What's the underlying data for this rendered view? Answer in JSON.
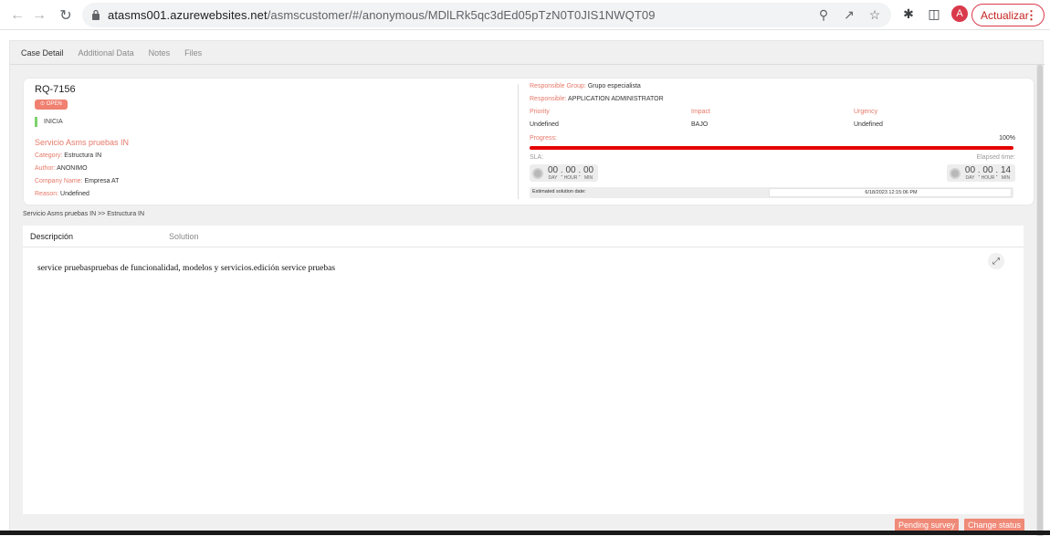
{
  "browser": {
    "url_host": "atasms001.azurewebsites.net",
    "url_path": "/asmscustomer/#/anonymous/MDlLRk5qc3dEd05pTzN0T0JIS1NWQT09",
    "avatar_letter": "A",
    "update_label": "Actualizar",
    "icons": [
      "back-arrow-icon",
      "forward-arrow-icon",
      "reload-icon",
      "lock-icon",
      "zoom-icon",
      "share-icon",
      "star-icon",
      "extensions-icon",
      "sidepanel-icon",
      "kebab-menu-icon"
    ]
  },
  "tabs": [
    "Case Detail",
    "Additional Data",
    "Notes",
    "Files"
  ],
  "case": {
    "id": "RQ-7156",
    "status": "⊙ OPEN",
    "stage": "INICIA",
    "service_title": "Servicio Asms pruebas IN",
    "category_key": "Category: ",
    "category_val": "Estructura IN",
    "author_key": "Author: ",
    "author_val": "ANONIMO",
    "company_key": "Company Name: ",
    "company_val": "Empresa AT",
    "reason_key": "Reason: ",
    "reason_val": "Undefined",
    "stage_color": "#7ed36b",
    "status_color": "#f08070"
  },
  "right": {
    "group_key": "Responsible Group: ",
    "group_val": "Grupo especialista",
    "resp_key": "Responsible: ",
    "resp_val": "APPLICATION ADMINISTRATOR",
    "priority_head": "Priority",
    "priority_val": "Undefined",
    "impact_head": "Impact",
    "impact_val": "BAJO",
    "urgency_head": "Urgency",
    "urgency_val": "Undefined",
    "progress_label": "Progress:",
    "progress_pct": "100%",
    "progress_value": 1.0,
    "sla_label": "SLA:",
    "elapsed_label": "Elapsed time:",
    "sla": {
      "day": "00",
      "hour": "00",
      "min": "00"
    },
    "elapsed": {
      "day": "00",
      "hour": "00",
      "min": "14"
    },
    "units": {
      "day": "DAY",
      "hour": "HOUR",
      "min": "MIN"
    },
    "est_label": "Estimated solution date:",
    "est_value": "6/18/2023 12:15:06 PM"
  },
  "breadcrumb": "Servicio Asms pruebas IN >> Estructura IN",
  "panel": {
    "tab_description": "Descripción",
    "tab_solution": "Solution",
    "description": "service pruebaspruebas de funcionalidad, modelos y servicios.edición service pruebas"
  },
  "actions": {
    "pending_survey": "Pending survey",
    "change_status": "Change status"
  },
  "colors": {
    "accent": "#e6796a",
    "progress": "#e50000",
    "button": "#f08a78"
  }
}
